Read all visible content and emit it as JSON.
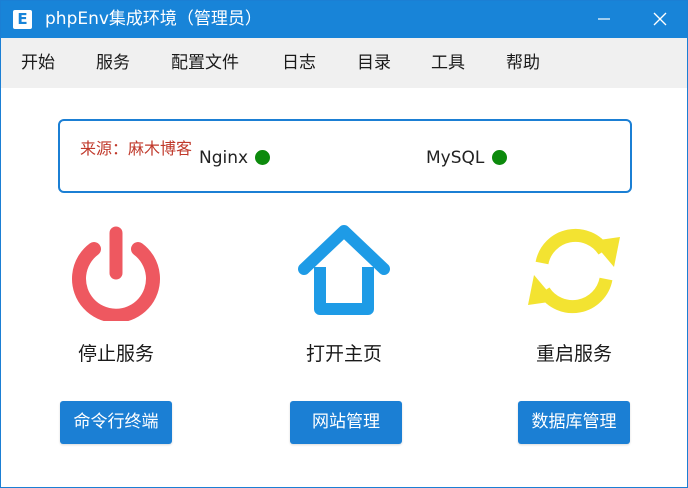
{
  "window": {
    "title": "phpEnv集成环境（管理员）",
    "app_icon_letter": "E",
    "minimize_icon": "minimize-icon",
    "close_icon": "close-icon",
    "accent_color": "#1884d8"
  },
  "menu": {
    "items": [
      "开始",
      "服务",
      "配置文件",
      "日志",
      "目录",
      "工具",
      "帮助"
    ]
  },
  "status": {
    "watermark": "来源：麻木博客",
    "services": [
      {
        "name": "Nginx",
        "status_color": "#0c8a0c"
      },
      {
        "name": "MySQL",
        "status_color": "#0c8a0c"
      }
    ]
  },
  "actions": [
    {
      "label": "停止服务",
      "icon": "power-icon",
      "color": "#ee5860"
    },
    {
      "label": "打开主页",
      "icon": "home-icon",
      "color": "#1e9be6"
    },
    {
      "label": "重启服务",
      "icon": "refresh-icon",
      "color": "#f3e331"
    }
  ],
  "buttons": {
    "terminal": "命令行终端",
    "sites": "网站管理",
    "database": "数据库管理"
  }
}
